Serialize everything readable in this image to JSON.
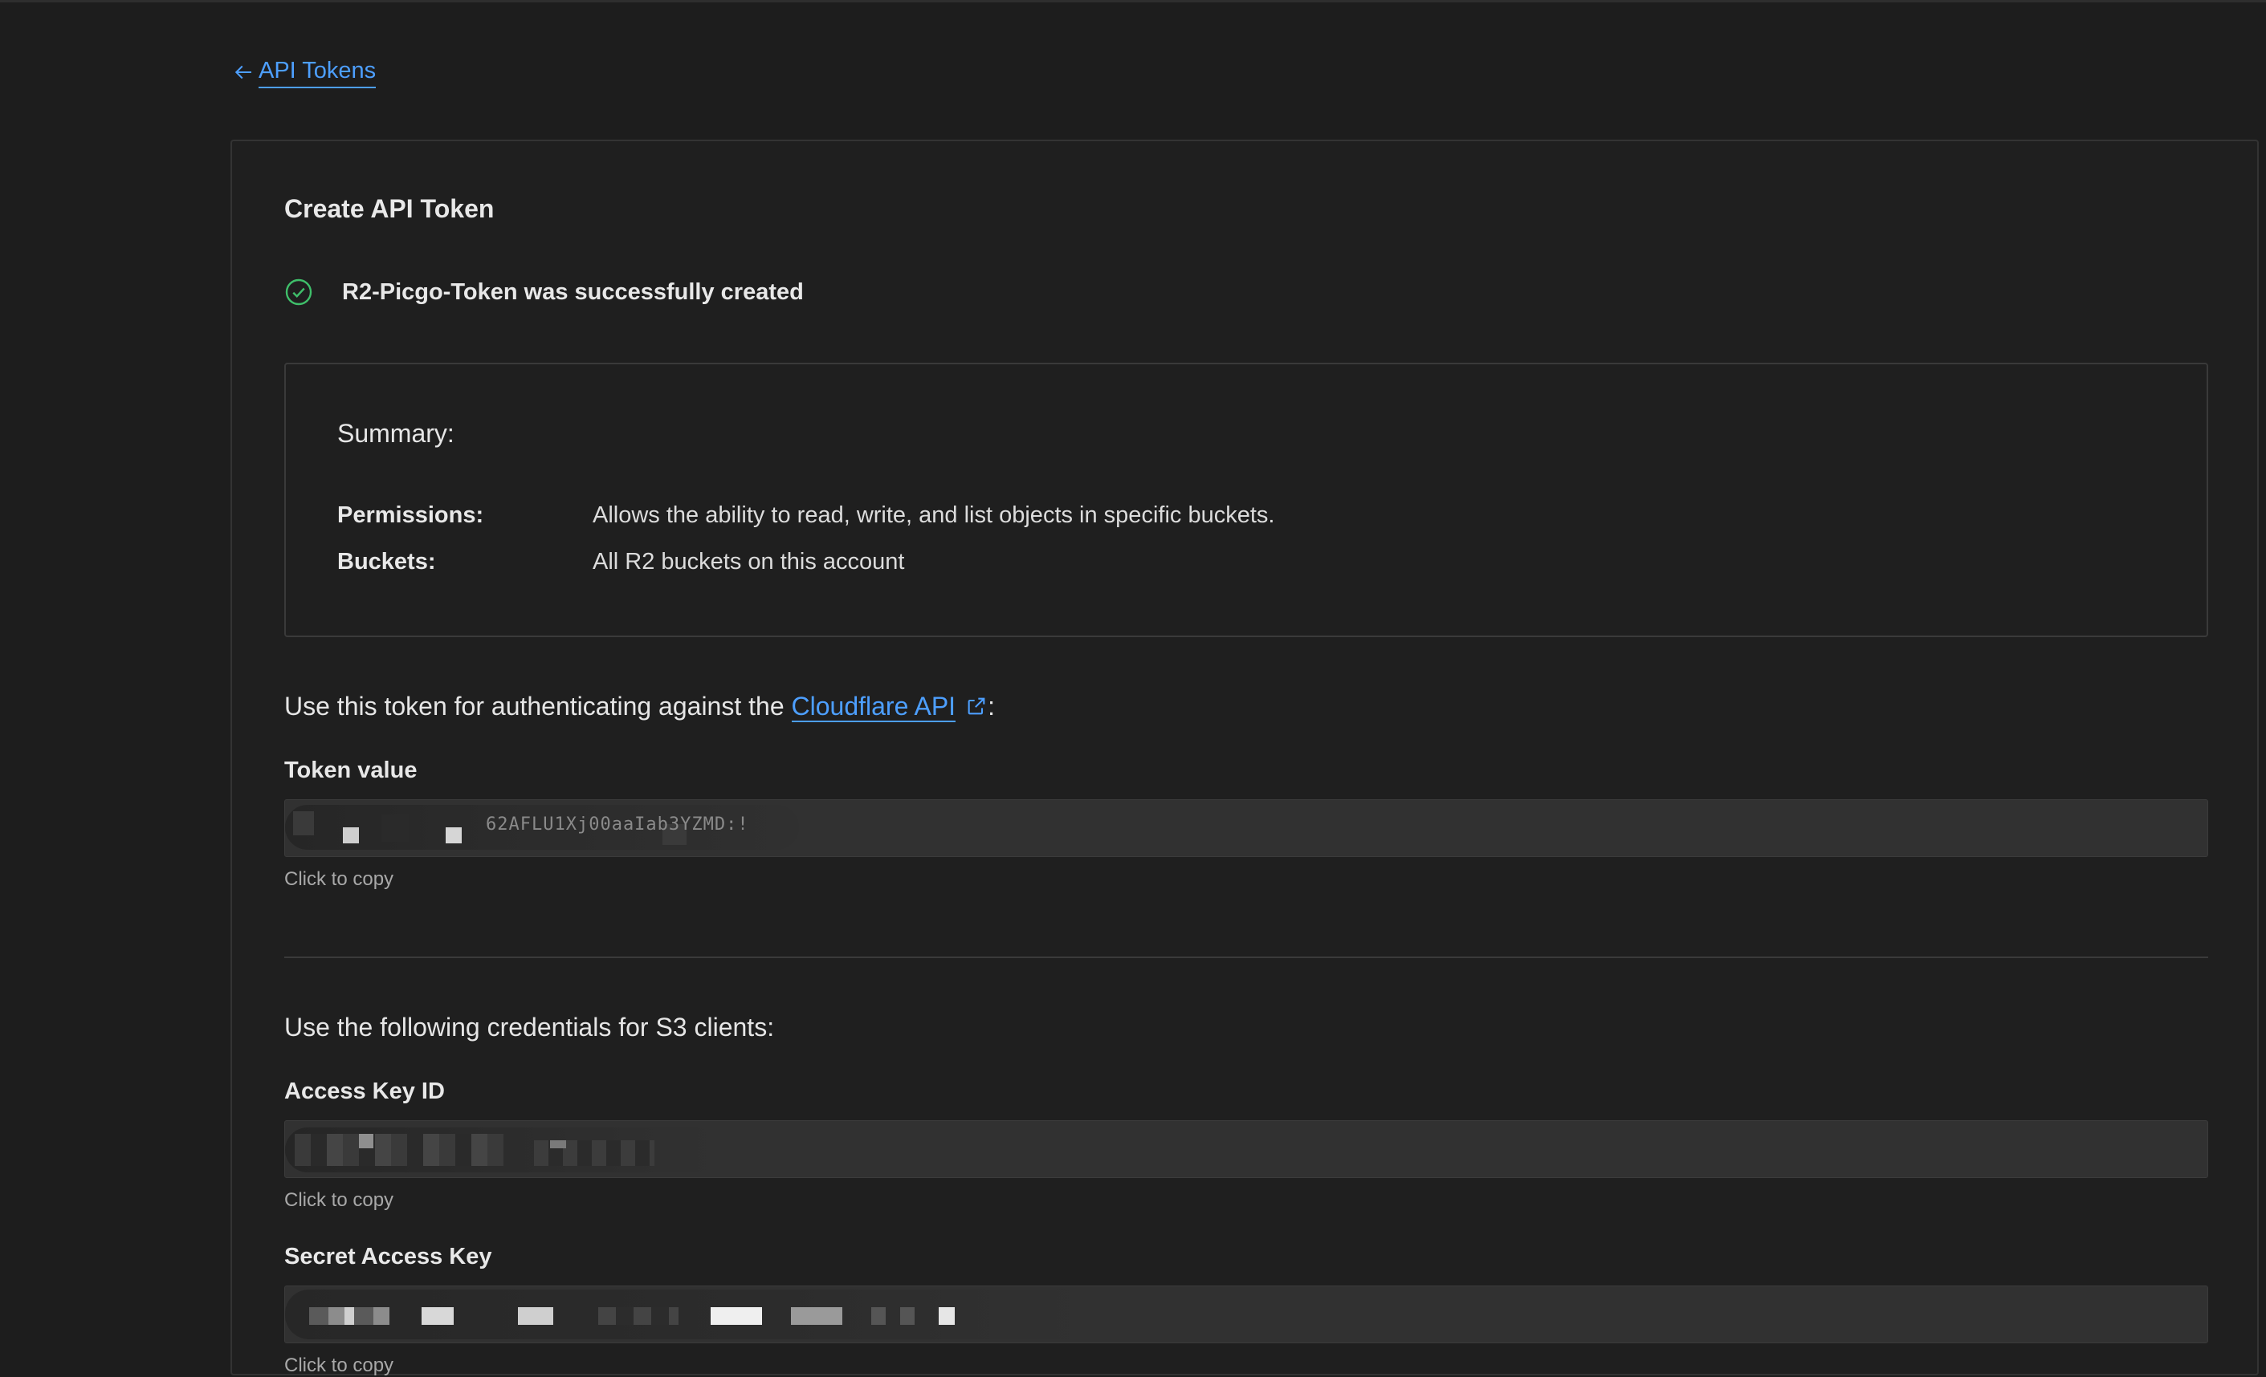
{
  "nav": {
    "back_label": "API Tokens"
  },
  "card": {
    "title": "Create API Token",
    "success_message": "R2-Picgo-Token was successfully created",
    "summary": {
      "heading": "Summary:",
      "permissions_label": "Permissions:",
      "permissions_value": "Allows the ability to read, write, and list objects in specific buckets.",
      "buckets_label": "Buckets:",
      "buckets_value": "All R2 buckets on this account"
    },
    "token_section": {
      "intro_prefix": "Use this token for authenticating against the ",
      "link_text": "Cloudflare API",
      "intro_suffix": ":",
      "label": "Token value",
      "masked_value": "62AFLU1Xj00aaIab3YZMD:!",
      "hint": "Click to copy"
    },
    "s3_section": {
      "intro": "Use the following credentials for S3 clients:",
      "access_key_label": "Access Key ID",
      "access_key_hint": "Click to copy",
      "secret_key_label": "Secret Access Key",
      "secret_key_hint": "Click to copy"
    }
  },
  "colors": {
    "background": "#1d1d1d",
    "link": "#4d9fff",
    "success": "#3fbf6a",
    "field_bg": "#313131"
  }
}
